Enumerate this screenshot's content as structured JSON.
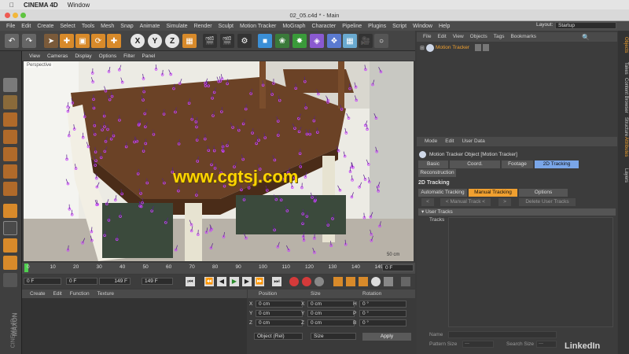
{
  "mac_menu": {
    "app": "CINEMA 4D",
    "items": [
      "Window"
    ]
  },
  "window_title": "02_05.c4d * - Main",
  "layout": {
    "label": "Layout:",
    "value": "Startup"
  },
  "main_menu": [
    "File",
    "Edit",
    "Create",
    "Select",
    "Tools",
    "Mesh",
    "Snap",
    "Animate",
    "Simulate",
    "Render",
    "Sculpt",
    "Motion Tracker",
    "MoGraph",
    "Character",
    "Pipeline",
    "Plugins",
    "Script",
    "Window",
    "Help"
  ],
  "toolbar": {
    "x": "X",
    "y": "Y",
    "z": "Z"
  },
  "viewport": {
    "menu": [
      "View",
      "Cameras",
      "Display",
      "Options",
      "Filter",
      "Panel"
    ],
    "label": "Perspective",
    "watermark": "www.cgtsj.com",
    "scale_readout": "50 cm"
  },
  "timeline": {
    "ticks": [
      "0",
      "10",
      "20",
      "30",
      "40",
      "50",
      "60",
      "70",
      "80",
      "90",
      "100",
      "110",
      "120",
      "130",
      "140",
      "149"
    ],
    "end_frame": "0 F"
  },
  "transport": {
    "current": "0 F",
    "start": "0 F",
    "end": "149 F",
    "end2": "149 F"
  },
  "materials": {
    "menu": [
      "Create",
      "Edit",
      "Function",
      "Texture"
    ],
    "brand1": "MAXON",
    "brand2": "CINEMA 4D"
  },
  "coords": {
    "headers": [
      "Position",
      "Size",
      "Rotation"
    ],
    "axes_pos": [
      "X",
      "Y",
      "Z"
    ],
    "axes_size": [
      "X",
      "Y",
      "Z"
    ],
    "axes_rot": [
      "H",
      "P",
      "B"
    ],
    "pos": [
      "0 cm",
      "0 cm",
      "0 cm"
    ],
    "size": [
      "0 cm",
      "0 cm",
      "0 cm"
    ],
    "rot": [
      "0 °",
      "0 °",
      "0 °"
    ],
    "mode": "Object (Rel)",
    "size_mode": "Size",
    "apply": "Apply"
  },
  "objects": {
    "menu": [
      "File",
      "Edit",
      "View",
      "Objects",
      "Tags",
      "Bookmarks"
    ],
    "item": "Motion Tracker"
  },
  "attributes": {
    "menu": [
      "Mode",
      "Edit",
      "User Data"
    ],
    "title": "Motion Tracker Object [Motion Tracker]",
    "tabs": [
      "Basic",
      "Coord.",
      "Footage",
      "2D Tracking"
    ],
    "tab2": "Reconstruction",
    "section": "2D Tracking",
    "subtabs": [
      "Automatic Tracking",
      "Manual Tracking",
      "Options"
    ],
    "buttons": [
      "<",
      "< Manual Track <",
      ">",
      "Delete User Tracks"
    ],
    "group": "User Tracks",
    "tracks_label": "Tracks",
    "name_label": "Name",
    "pattern_label": "Pattern Size",
    "pattern_value": "---",
    "search_label": "Search Size",
    "search_value": "---"
  },
  "right_tabs": [
    "Objects",
    "Takes",
    "Content Browser",
    "Structure",
    "Attributes",
    "Layers"
  ],
  "watermark_brand": "LinkedIn",
  "colors": {
    "accent_orange": "#f0a030",
    "active_blue": "#7aa6e8",
    "grid_purple": "#cc44ff"
  }
}
